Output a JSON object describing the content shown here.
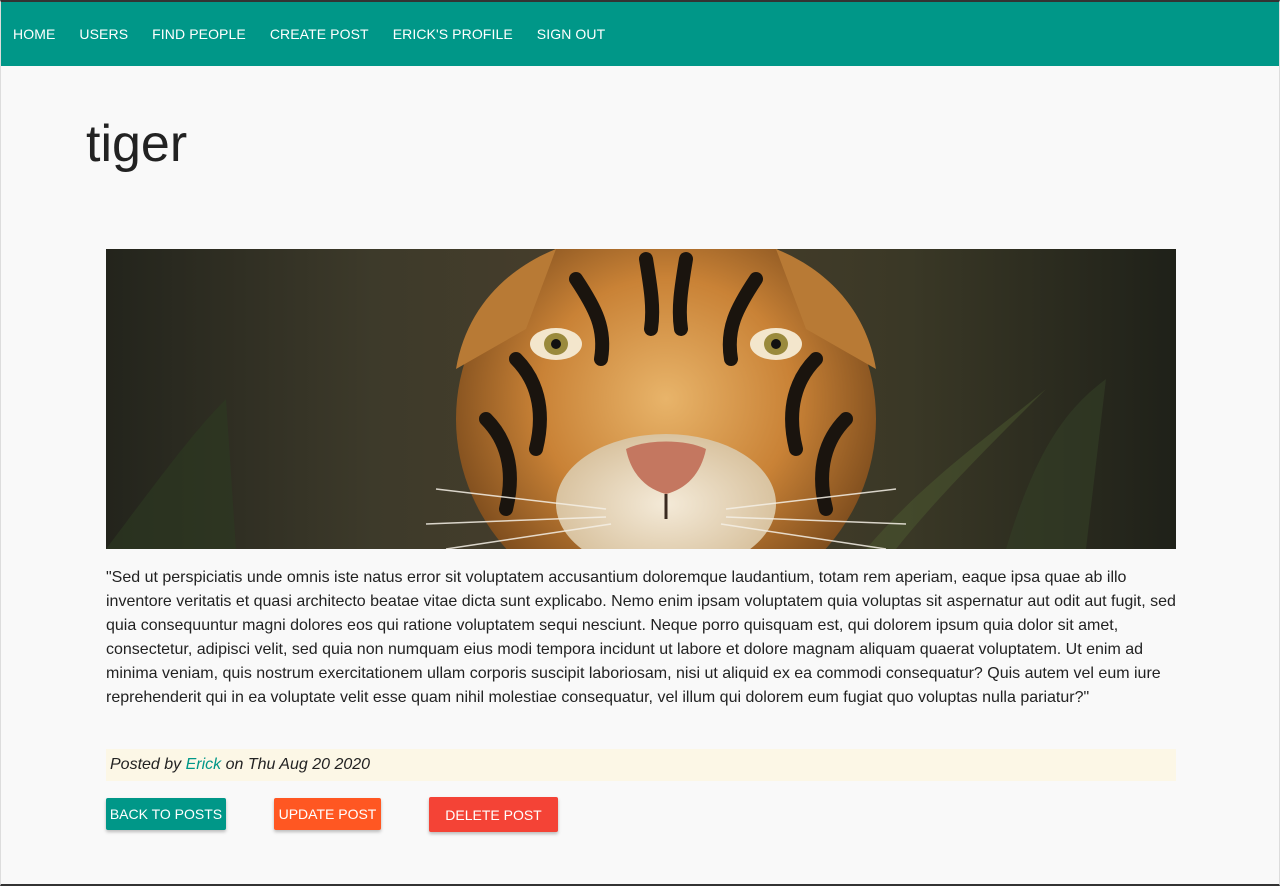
{
  "nav": {
    "items": [
      "HOME",
      "USERS",
      "FIND PEOPLE",
      "CREATE POST",
      "ERICK'S PROFILE",
      "SIGN OUT"
    ]
  },
  "post": {
    "title": "tiger",
    "image_alt": "tiger",
    "body": "\"Sed ut perspiciatis unde omnis iste natus error sit voluptatem accusantium doloremque laudantium, totam rem aperiam, eaque ipsa quae ab illo inventore veritatis et quasi architecto beatae vitae dicta sunt explicabo. Nemo enim ipsam voluptatem quia voluptas sit aspernatur aut odit aut fugit, sed quia consequuntur magni dolores eos qui ratione voluptatem sequi nesciunt. Neque porro quisquam est, qui dolorem ipsum quia dolor sit amet, consectetur, adipisci velit, sed quia non numquam eius modi tempora incidunt ut labore et dolore magnam aliquam quaerat voluptatem. Ut enim ad minima veniam, quis nostrum exercitationem ullam corporis suscipit laboriosam, nisi ut aliquid ex ea commodi consequatur? Quis autem vel eum iure reprehenderit qui in ea voluptate velit esse quam nihil molestiae consequatur, vel illum qui dolorem eum fugiat quo voluptas nulla pariatur?\"",
    "meta": {
      "posted_by_label": "Posted by",
      "author": "Erick",
      "on_label": "on",
      "date": "Thu Aug 20 2020"
    }
  },
  "actions": {
    "back_label": "BACK TO POSTS",
    "update_label": "UPDATE POST",
    "delete_label": "DELETE POST"
  },
  "colors": {
    "navbar": "#009788",
    "back_button": "#009788",
    "update_button": "#ff5722",
    "delete_button": "#f44336",
    "meta_background": "#fcf7e6",
    "author_link": "#009788"
  }
}
